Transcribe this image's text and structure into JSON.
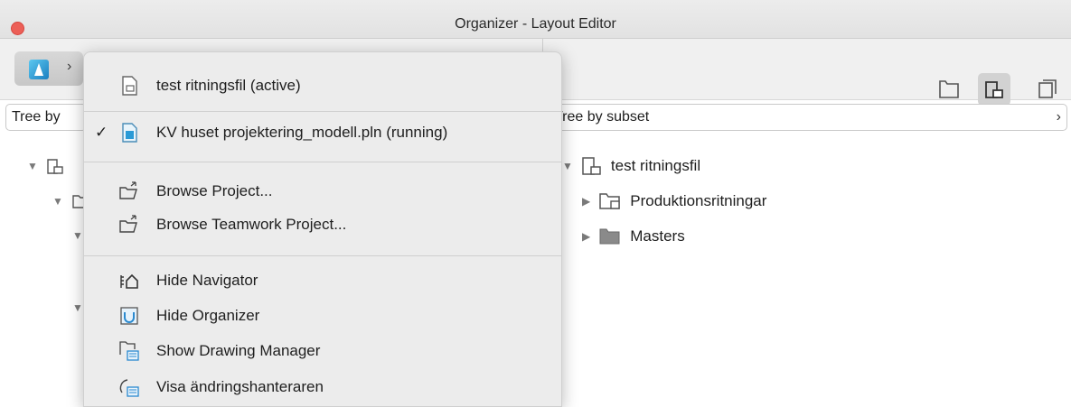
{
  "window": {
    "title": "Organizer - Layout Editor"
  },
  "toolbar": {
    "view_icons": [
      "project-map-icon",
      "layout-book-icon",
      "publisher-sets-icon"
    ]
  },
  "left_panel": {
    "selector_label": "Tree by",
    "tree": [
      {
        "icon": "layout-book-icon",
        "label": ""
      }
    ]
  },
  "right_panel": {
    "selector_label": "Tree by subset",
    "tree": [
      {
        "label": "test ritningsfil",
        "icon": "layout-book-icon",
        "expanded": true
      },
      {
        "label": "Produktionsritningar",
        "icon": "subset-folder-icon",
        "expanded": false
      },
      {
        "label": "Masters",
        "icon": "folder-icon",
        "expanded": false
      }
    ]
  },
  "menu": {
    "items": [
      {
        "label": "test ritningsfil (active)",
        "icon": "layout-file-icon",
        "checked": false
      },
      {
        "label": "KV huset projektering_modell.pln (running)",
        "icon": "archicad-file-icon",
        "checked": true
      },
      {
        "label": "Browse Project...",
        "icon": "browse-folder-icon"
      },
      {
        "label": "Browse Teamwork Project...",
        "icon": "browse-folder-icon"
      },
      {
        "label": "Hide Navigator",
        "icon": "navigator-icon"
      },
      {
        "label": "Hide Organizer",
        "icon": "organizer-icon"
      },
      {
        "label": "Show Drawing Manager",
        "icon": "drawing-manager-icon"
      },
      {
        "label": "Visa ändringshanteraren",
        "icon": "change-manager-icon"
      }
    ],
    "checkmark": "✓"
  },
  "colors": {
    "close": "#ec5f57",
    "accent": "#1a7fc0"
  }
}
